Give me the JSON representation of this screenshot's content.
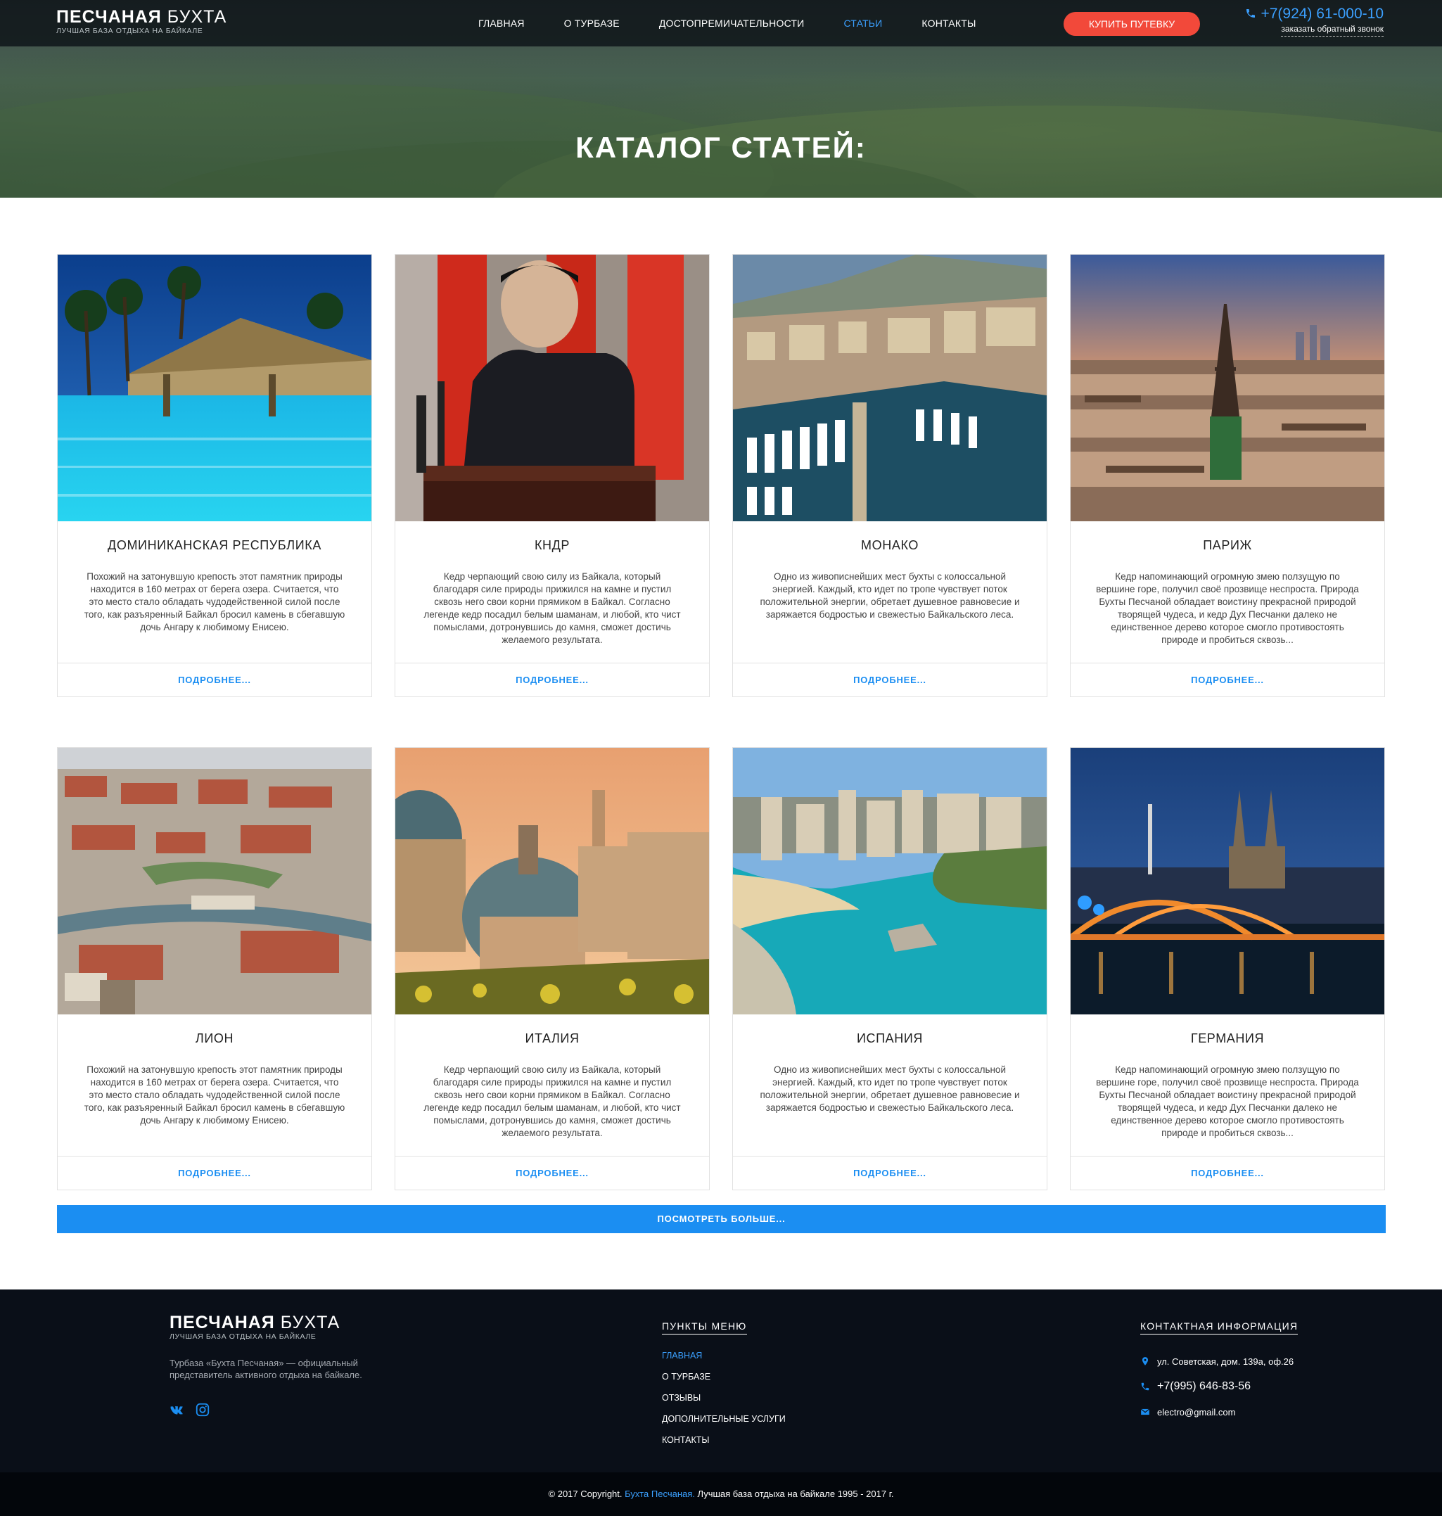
{
  "header": {
    "logo_bold": "ПЕСЧАНАЯ",
    "logo_light": "БУХТА",
    "logo_sub": "лучшая база отдыха на байкале",
    "nav": [
      {
        "label": "ГЛАВНАЯ",
        "active": false
      },
      {
        "label": "О ТУРБАЗЕ",
        "active": false
      },
      {
        "label": "ДОСТОПРЕМИЧАТЕЛЬНОСТИ",
        "active": false
      },
      {
        "label": "СТАТЬИ",
        "active": true
      },
      {
        "label": "КОНТАКТЫ",
        "active": false
      }
    ],
    "buy_label": "КУПИТЬ ПУТЕВКУ",
    "phone": "+7(924) 61-000-10",
    "callback": "заказать обратный звонок"
  },
  "hero": {
    "title": "КАТАЛОГ СТАТЕЙ:"
  },
  "cards": [
    {
      "title": "ДОМИНИКАНСКАЯ РЕСПУБЛИКА",
      "text": "Похожий на затонувшую крепость этот памятник природы находится в 160 метрах от берега озера. Считается, что это место стало обладать чудодейственной силой после того, как разъяренный Байкал бросил камень в сбегавшую дочь Ангару к любимому Енисею.",
      "more": "ПОДРОБНЕЕ..."
    },
    {
      "title": "КНДР",
      "text": "Кедр черпающий свою силу из Байкала, который благодаря силе природы прижился на камне и пустил сквозь него свои корни прямиком в Байкал. Согласно легенде кедр посадил белым шаманам, и любой, кто чист помыслами, дотронувшись до камня, сможет достичь желаемого результата.",
      "more": "ПОДРОБНЕЕ..."
    },
    {
      "title": "МОНАКО",
      "text": "Одно из живописнейших мест бухты с колоссальной энергией. Каждый, кто идет по тропе чувствует поток положительной энергии, обретает душевное равновесие и заряжается бодростью и свежестью Байкальского леса.",
      "more": "ПОДРОБНЕЕ..."
    },
    {
      "title": "ПАРИЖ",
      "text": "Кедр напоминающий огромную змею ползущую по вершине горе, получил своё прозвище неспроста. Природа Бухты Песчаной обладает воистину прекрасной природой творящей чудеса, и кедр Дух Песчанки далеко не единственное дерево которое смогло противостоять природе и пробиться сквозь...",
      "more": "ПОДРОБНЕЕ..."
    },
    {
      "title": "ЛИОН",
      "text": "Похожий на затонувшую крепость этот памятник природы находится в 160 метрах от берега озера. Считается, что это место стало обладать чудодейственной силой после того, как разъяренный Байкал бросил камень в сбегавшую дочь Ангару к любимому Енисею.",
      "more": "ПОДРОБНЕЕ..."
    },
    {
      "title": "ИТАЛИЯ",
      "text": "Кедр черпающий свою силу из Байкала, который благодаря силе природы прижился на камне и пустил сквозь него свои корни прямиком в Байкал. Согласно легенде кедр посадил белым шаманам, и любой, кто чист помыслами, дотронувшись до камня, сможет достичь желаемого результата.",
      "more": "ПОДРОБНЕЕ..."
    },
    {
      "title": "ИСПАНИЯ",
      "text": "Одно из живописнейших мест бухты с колоссальной энергией. Каждый, кто идет по тропе чувствует поток положительной энергии, обретает душевное равновесие и заряжается бодростью и свежестью Байкальского леса.",
      "more": "ПОДРОБНЕЕ..."
    },
    {
      "title": "ГЕРМАНИЯ",
      "text": "Кедр напоминающий огромную змею ползущую по вершине горе, получил своё прозвище неспроста. Природа Бухты Песчаной обладает воистину прекрасной природой творящей чудеса, и кедр Дух Песчанки далеко не единственное дерево которое смогло противостоять природе и пробиться сквозь...",
      "more": "ПОДРОБНЕЕ..."
    }
  ],
  "more_button": "ПОСМОТРЕТЬ БОЛЬШЕ...",
  "footer": {
    "logo_bold": "ПЕСЧАНАЯ",
    "logo_light": "БУХТА",
    "logo_sub": "лучшая база отдыха на байкале",
    "description": "Турбаза «Бухта Песчаная» — официальный представитель активного отдыха на байкале.",
    "social": [
      "vk-icon",
      "instagram-icon"
    ],
    "menu_title": "ПУНКТЫ МЕНЮ",
    "menu": [
      {
        "label": "ГЛАВНАЯ",
        "active": true
      },
      {
        "label": "О ТУРБАЗЕ",
        "active": false
      },
      {
        "label": "ОТЗЫВЫ",
        "active": false
      },
      {
        "label": "ДОПОЛНИТЕЛЬНЫЕ УСЛУГИ",
        "active": false
      },
      {
        "label": "КОНТАКТЫ",
        "active": false
      }
    ],
    "contacts_title": "КОНТАКТНАЯ ИНФОРМАЦИЯ",
    "address": "ул. Советская, дом. 139а, оф.26",
    "phone": "+7(995) 646-83-56",
    "email": "electro@gmail.com"
  },
  "copyright": {
    "prefix": "© 2017 Copyright.",
    "brand": "Бухта Песчаная.",
    "suffix": "Лучшая база отдыха на байкале 1995 - 2017 г."
  },
  "colors": {
    "accent_blue": "#1b8ef2",
    "buy_red": "#f2493a",
    "footer_bg": "#0a0f18"
  }
}
